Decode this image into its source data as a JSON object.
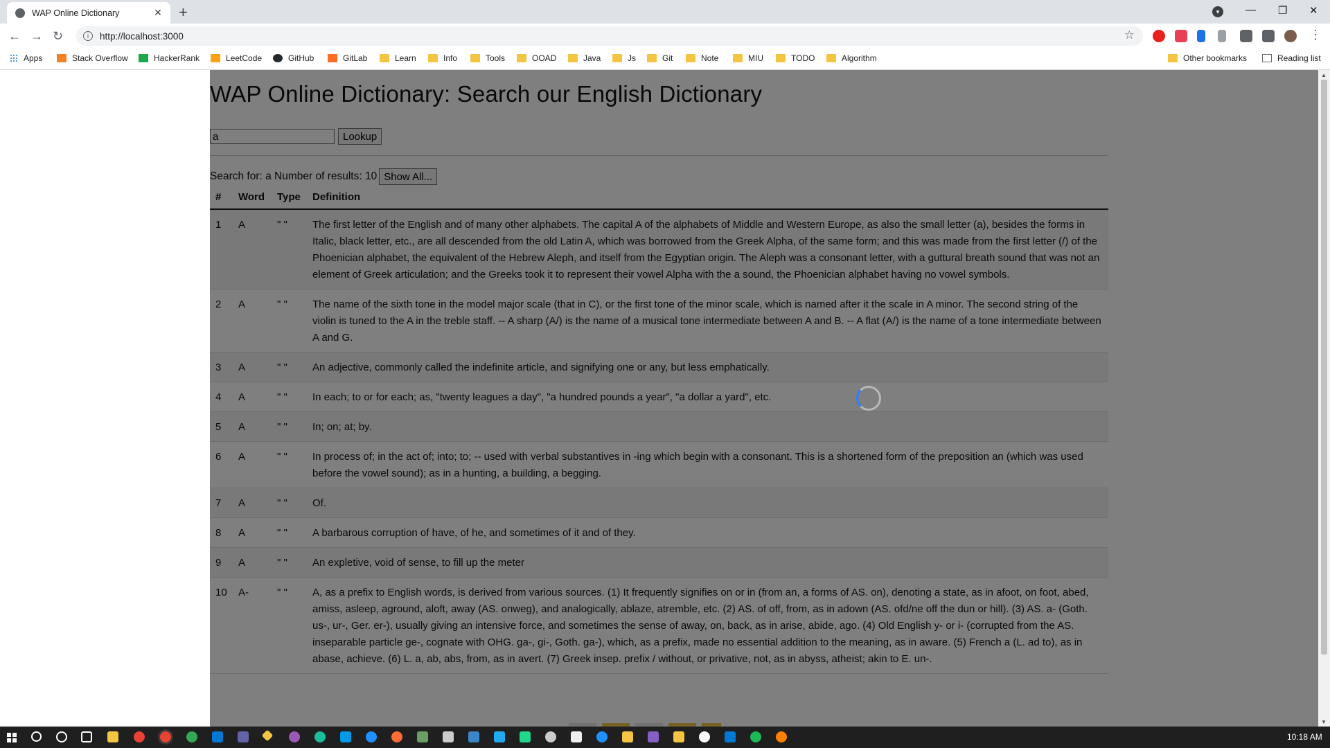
{
  "browser": {
    "tab_title": "WAP Online Dictionary",
    "url": "http://localhost:3000",
    "bookmarks": [
      {
        "label": "Apps",
        "icon": "apps-grid-icon"
      },
      {
        "label": "Stack Overflow",
        "icon": "stackoverflow-icon"
      },
      {
        "label": "HackerRank",
        "icon": "hackerrank-icon"
      },
      {
        "label": "LeetCode",
        "icon": "leetcode-icon"
      },
      {
        "label": "GitHub",
        "icon": "github-icon"
      },
      {
        "label": "GitLab",
        "icon": "gitlab-icon"
      },
      {
        "label": "Learn",
        "icon": "folder-icon"
      },
      {
        "label": "Info",
        "icon": "folder-icon"
      },
      {
        "label": "Tools",
        "icon": "folder-icon"
      },
      {
        "label": "OOAD",
        "icon": "folder-icon"
      },
      {
        "label": "Java",
        "icon": "folder-icon"
      },
      {
        "label": "Js",
        "icon": "folder-icon"
      },
      {
        "label": "Git",
        "icon": "folder-icon"
      },
      {
        "label": "Note",
        "icon": "folder-icon"
      },
      {
        "label": "MIU",
        "icon": "folder-icon"
      },
      {
        "label": "TODO",
        "icon": "folder-icon"
      },
      {
        "label": "Algorithm",
        "icon": "folder-icon"
      }
    ],
    "other_bookmarks": "Other bookmarks",
    "reading_list": "Reading list"
  },
  "page": {
    "heading": "WAP Online Dictionary: Search our English Dictionary",
    "search_value": "a",
    "lookup_label": "Lookup",
    "summary_text": "Search for: a Number of results: 10",
    "show_all_label": "Show All...",
    "columns": [
      "#",
      "Word",
      "Type",
      "Definition"
    ],
    "rows": [
      {
        "num": "1",
        "word": "A",
        "type": "\" \"",
        "definition": "The first letter of the English and of many other alphabets. The capital A of the alphabets of Middle and Western Europe, as also the small letter (a), besides the forms in Italic, black letter, etc., are all descended from the old Latin A, which was borrowed from the Greek Alpha, of the same form; and this was made from the first letter (/) of the Phoenician alphabet, the equivalent of the Hebrew Aleph, and itself from the Egyptian origin. The Aleph was a consonant letter, with a guttural breath sound that was not an element of Greek articulation; and the Greeks took it to represent their vowel Alpha with the a sound, the Phoenician alphabet having no vowel symbols."
      },
      {
        "num": "2",
        "word": "A",
        "type": "\" \"",
        "definition": "The name of the sixth tone in the model major scale (that in C), or the first tone of the minor scale, which is named after it the scale in A minor. The second string of the violin is tuned to the A in the treble staff. -- A sharp (A/) is the name of a musical tone intermediate between A and B. -- A flat (A/) is the name of a tone intermediate between A and G."
      },
      {
        "num": "3",
        "word": "A",
        "type": "\" \"",
        "definition": "An adjective, commonly called the indefinite article, and signifying one or any, but less emphatically."
      },
      {
        "num": "4",
        "word": "A",
        "type": "\" \"",
        "definition": "In each; to or for each; as, \"twenty leagues a day\", \"a hundred pounds a year\", \"a dollar a yard\", etc."
      },
      {
        "num": "5",
        "word": "A",
        "type": "\" \"",
        "definition": "In; on; at; by."
      },
      {
        "num": "6",
        "word": "A",
        "type": "\" \"",
        "definition": "In process of; in the act of; into; to; -- used with verbal substantives in -ing which begin with a consonant. This is a shortened form of the preposition an (which was used before the vowel sound); as in a hunting, a building, a begging."
      },
      {
        "num": "7",
        "word": "A",
        "type": "\" \"",
        "definition": "Of."
      },
      {
        "num": "8",
        "word": "A",
        "type": "\" \"",
        "definition": "A barbarous corruption of have, of he, and sometimes of it and of they."
      },
      {
        "num": "9",
        "word": "A",
        "type": "\" \"",
        "definition": "An expletive, void of sense, to fill up the meter"
      },
      {
        "num": "10",
        "word": "A-",
        "type": "\" \"",
        "definition": "A, as a prefix to English words, is derived from various sources. (1) It frequently signifies on or in (from an, a forms of AS. on), denoting a state, as in afoot, on foot, abed, amiss, asleep, aground, aloft, away (AS. onweg), and analogically, ablaze, atremble, etc. (2) AS. of off, from, as in adown (AS. ofd/ne off the dun or hill). (3) AS. a- (Goth. us-, ur-, Ger. er-), usually giving an intensive force, and sometimes the sense of away, on, back, as in arise, abide, ago. (4) Old English y- or i- (corrupted from the AS. inseparable particle ge-, cognate with OHG. ga-, gi-, Goth. ga-), which, as a prefix, made no essential addition to the meaning, as in aware. (5) French a (L. ad to), as in abase, achieve. (6) L. a, ab, abs, from, as in avert. (7) Greek insep. prefix / without, or privative, not, as in abyss, atheist; akin to E. un-."
      }
    ],
    "loading": true
  },
  "taskbar": {
    "clock": "10:18 AM"
  },
  "colors": {
    "overlay": "#000000",
    "spinner_accent": "#2a7fff",
    "folder": "#f4c542"
  }
}
